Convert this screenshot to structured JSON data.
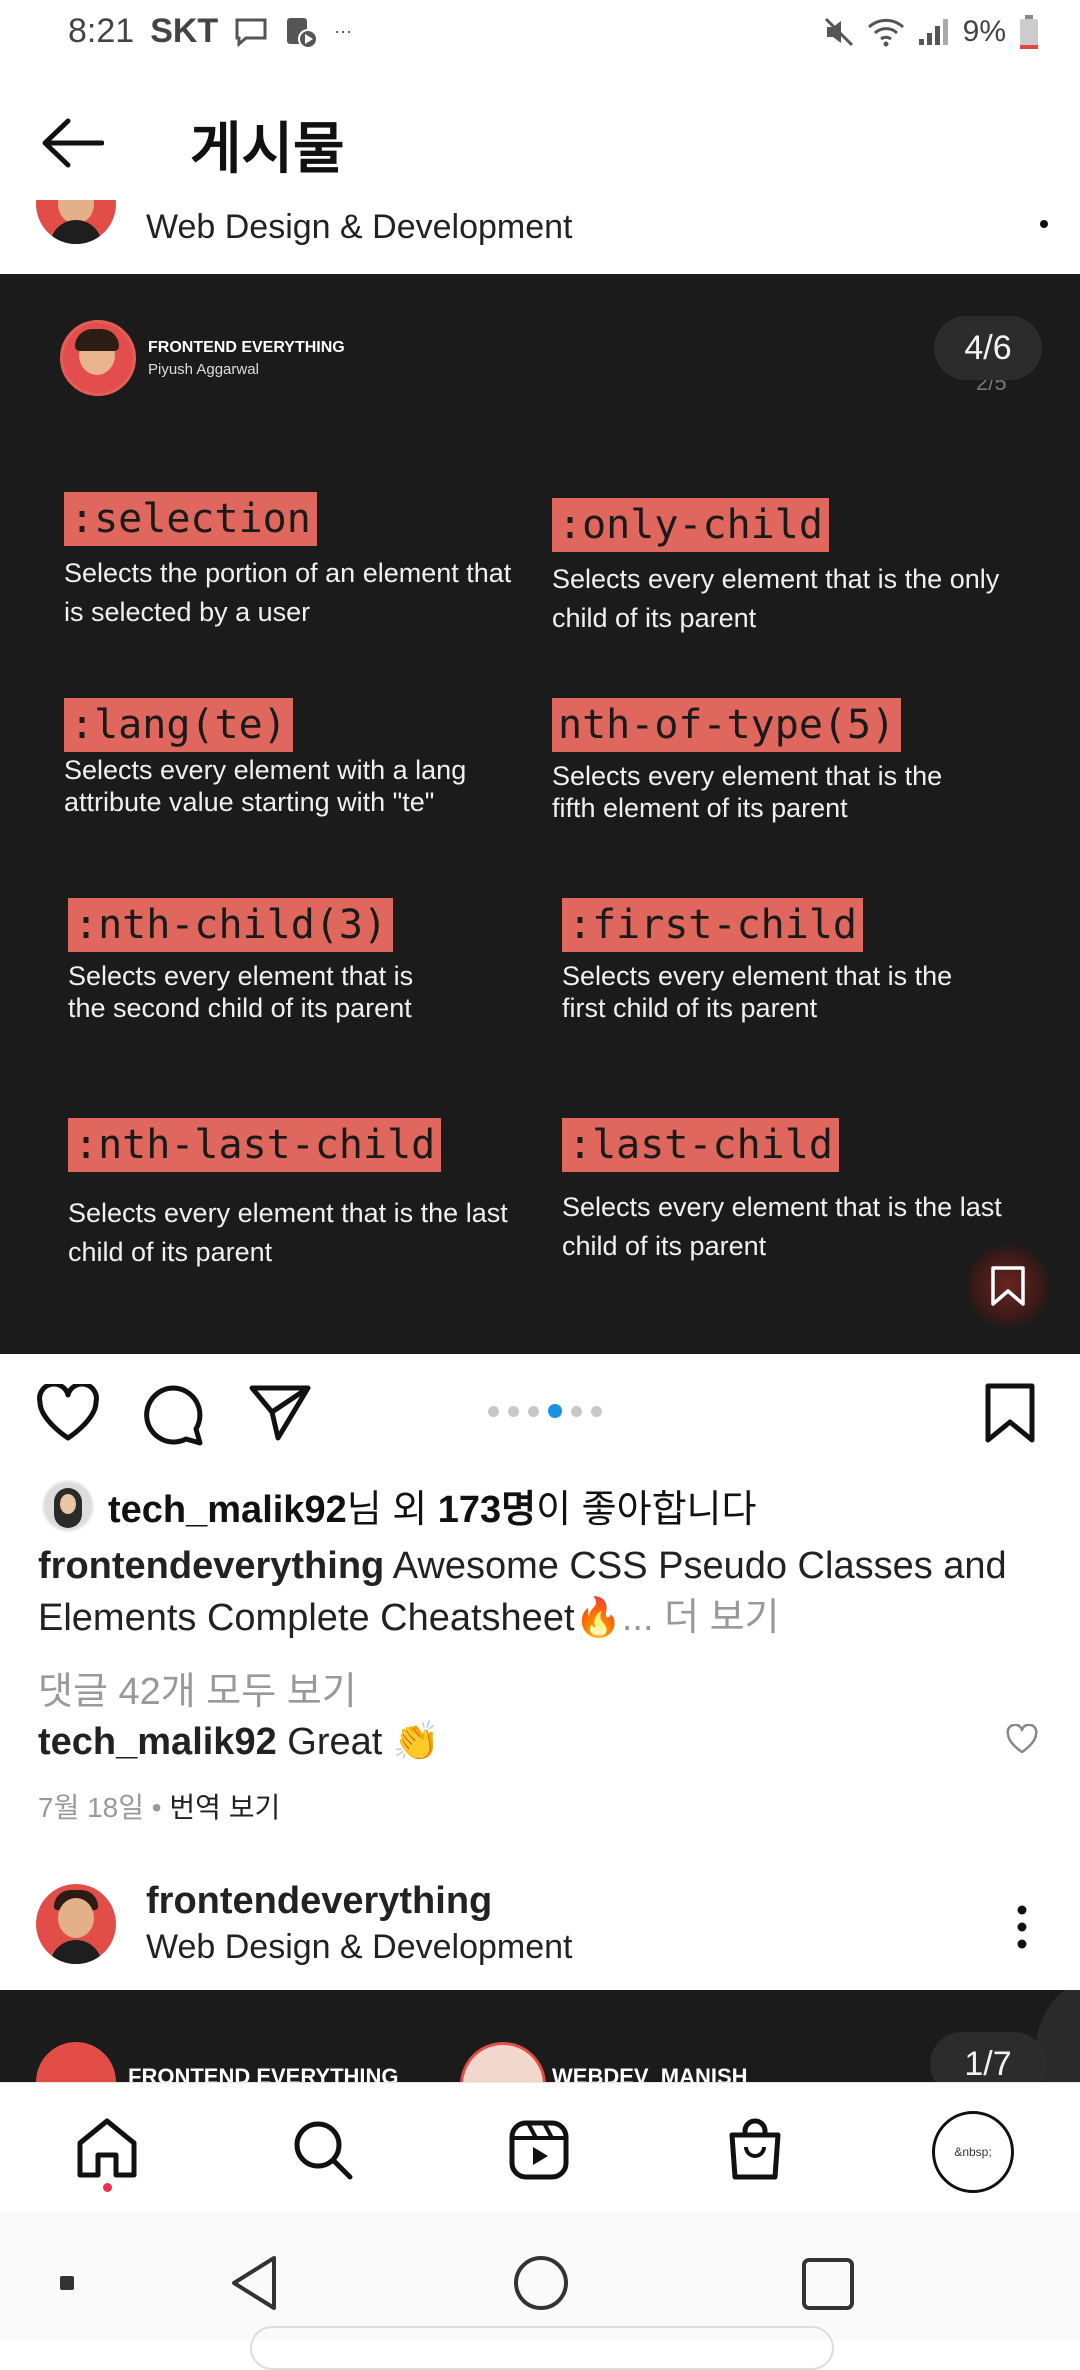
{
  "status": {
    "time": "8:21",
    "carrier": "SKT",
    "extra": "···",
    "battery": "9%"
  },
  "header": {
    "title": "게시물"
  },
  "prev_post": {
    "subtitle": "Web Design & Development"
  },
  "post": {
    "counter": "4/6",
    "brand_name": "FRONTEND EVERYTHING",
    "brand_author": "Piyush Aggarwal",
    "behind_counter": "2/5",
    "items": [
      {
        "code": ":selection",
        "desc": "Selects the portion of an element that is selected by a user"
      },
      {
        "code": ":only-child",
        "desc": "Selects every element that is the only child of its parent"
      },
      {
        "code": ":lang(te)",
        "desc": "Selects every element with a lang attribute value starting with \"te\""
      },
      {
        "code": "nth-of-type(5)",
        "desc": "Selects every element that is the fifth element of its parent"
      },
      {
        "code": ":nth-child(3)",
        "desc": "Selects every element that is the second child of its parent"
      },
      {
        "code": ":first-child",
        "desc": "Selects every element that is the first child of its parent"
      },
      {
        "code": ":nth-last-child",
        "desc": "Selects every element that is the last child of its parent"
      },
      {
        "code": ":last-child",
        "desc": "Selects every element that is the last child of its parent"
      }
    ]
  },
  "carousel": {
    "count": 6,
    "active_index": 3
  },
  "likes": {
    "user": "tech_malik92",
    "rest_prefix": "님 외 ",
    "count": "173명",
    "suffix": "이 좋아합니다"
  },
  "caption": {
    "user": "frontendeverything",
    "text": " Awesome CSS Pseudo Classes and Elements Complete Cheatsheet",
    "emoji": "🔥",
    "more": "... 더 보기"
  },
  "comments": {
    "view_all": "댓글 42개 모두 보기",
    "user": "tech_malik92",
    "text": " Great ",
    "emoji": "👏"
  },
  "meta": {
    "date": "7월 18일",
    "dot": " • ",
    "translate": "번역 보기"
  },
  "next_post": {
    "author": "frontendeverything",
    "subtitle": "Web Design & Development",
    "counter": "1/7",
    "peek_left": "FRONTEND EVERYTHING",
    "peek_right": "WEBDEV_MANISH"
  },
  "bottom_nav": {
    "profile_label": "&nbsp;"
  }
}
